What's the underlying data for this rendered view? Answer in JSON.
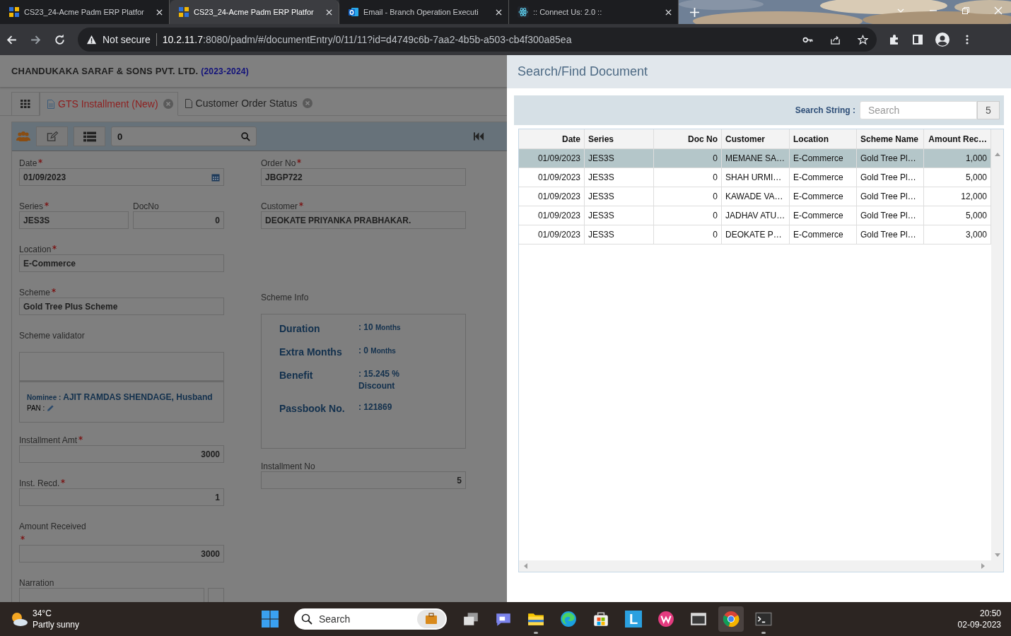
{
  "browser": {
    "tabs": [
      {
        "title": "CS23_24-Acme Padm ERP Platfor",
        "kind": "erp",
        "selected": false
      },
      {
        "title": "CS23_24-Acme Padm ERP Platfor",
        "kind": "erp",
        "selected": true
      },
      {
        "title": "Email - Branch Operation Executi",
        "kind": "mail",
        "selected": false
      },
      {
        "title": ":: Connect Us: 2.0 ::",
        "kind": "atom",
        "selected": false
      }
    ],
    "security": "Not secure",
    "url_host": "10.2.11.7",
    "url_rest": ":8080/padm/#/documentEntry/0/11/11?id=d4749c6b-7aa2-4b5b-a503-cb4f300a85ea"
  },
  "app": {
    "company": "CHANDUKAKA SARAF & SONS PVT. LTD.",
    "year": "(2023-2024)",
    "tabs": [
      {
        "label": "GTS Installment (New)",
        "selected": true
      },
      {
        "label": "Customer Order Status",
        "selected": false
      }
    ],
    "toolbar_search": "0",
    "left_fields": [
      {
        "kind": "date",
        "label": "Date",
        "required": true,
        "value": "01/09/2023"
      },
      {
        "kind": "pair",
        "label": "Series",
        "required": true,
        "value": "JES3S",
        "label2": "DocNo",
        "value2": "0"
      },
      {
        "kind": "text",
        "label": "Location",
        "required": true,
        "value": "E-Commerce"
      },
      {
        "kind": "text",
        "label": "Scheme",
        "required": true,
        "value": "Gold Tree Plus Scheme"
      },
      {
        "kind": "validator",
        "label": "Scheme validator",
        "nominee_label": "Nominee :",
        "nominee": "AJIT RAMDAS SHENDAGE, Husband",
        "pan_label": "PAN :"
      },
      {
        "kind": "number",
        "label": "Installment Amt",
        "required": true,
        "value": "3000"
      },
      {
        "kind": "number",
        "label": "Inst. Recd.",
        "required": true,
        "value": "1"
      },
      {
        "kind": "number",
        "label": "Amount Received",
        "required": true,
        "value": "3000"
      },
      {
        "kind": "cut",
        "label": "Narration",
        "required": false
      }
    ],
    "right_fields": [
      {
        "kind": "text",
        "label": "Order No",
        "required": true,
        "value": "JBGP722"
      },
      {
        "kind": "text",
        "label": "Customer",
        "required": true,
        "value": "DEOKATE PRIYANKA PRABHAKAR."
      },
      {
        "kind": "info",
        "label": "Scheme Info",
        "required": false,
        "rows": [
          {
            "label": "Duration",
            "value": ": 10",
            "unit": "Months"
          },
          {
            "label": "Extra Months",
            "value": ": 0",
            "unit": "Months"
          },
          {
            "label": "Benefit",
            "value": ": 15.245 % Discount"
          },
          {
            "label": "Passbook No.",
            "value": ": 121869"
          }
        ]
      },
      {
        "kind": "number",
        "label": "Installment No",
        "required": false,
        "value": "5"
      }
    ]
  },
  "panel": {
    "title": "Search/Find Document",
    "search_label": "Search String :",
    "search_placeholder": "Search",
    "count": "5",
    "columns": [
      "Date",
      "Series",
      "Doc No",
      "Customer",
      "Location",
      "Scheme Name",
      "Amount Rec…"
    ],
    "rows": [
      {
        "cells": [
          "01/09/2023",
          "JES3S",
          "0",
          "MEMANE SA…",
          "E-Commerce",
          "Gold Tree Pl…",
          "1,000"
        ],
        "selected": true
      },
      {
        "cells": [
          "01/09/2023",
          "JES3S",
          "0",
          "SHAH URMI…",
          "E-Commerce",
          "Gold Tree Pl…",
          "5,000"
        ],
        "selected": false
      },
      {
        "cells": [
          "01/09/2023",
          "JES3S",
          "0",
          "KAWADE VA…",
          "E-Commerce",
          "Gold Tree Pl…",
          "12,000"
        ],
        "selected": false
      },
      {
        "cells": [
          "01/09/2023",
          "JES3S",
          "0",
          "JADHAV ATU…",
          "E-Commerce",
          "Gold Tree Pl…",
          "5,000"
        ],
        "selected": false
      },
      {
        "cells": [
          "01/09/2023",
          "JES3S",
          "0",
          "DEOKATE P…",
          "E-Commerce",
          "Gold Tree Pl…",
          "3,000"
        ],
        "selected": false
      }
    ]
  },
  "taskbar": {
    "temperature": "34°C",
    "condition": "Partly sunny",
    "search_placeholder": "Search",
    "app_letter": "L",
    "time": "20:50",
    "date": "02-09-2023"
  }
}
